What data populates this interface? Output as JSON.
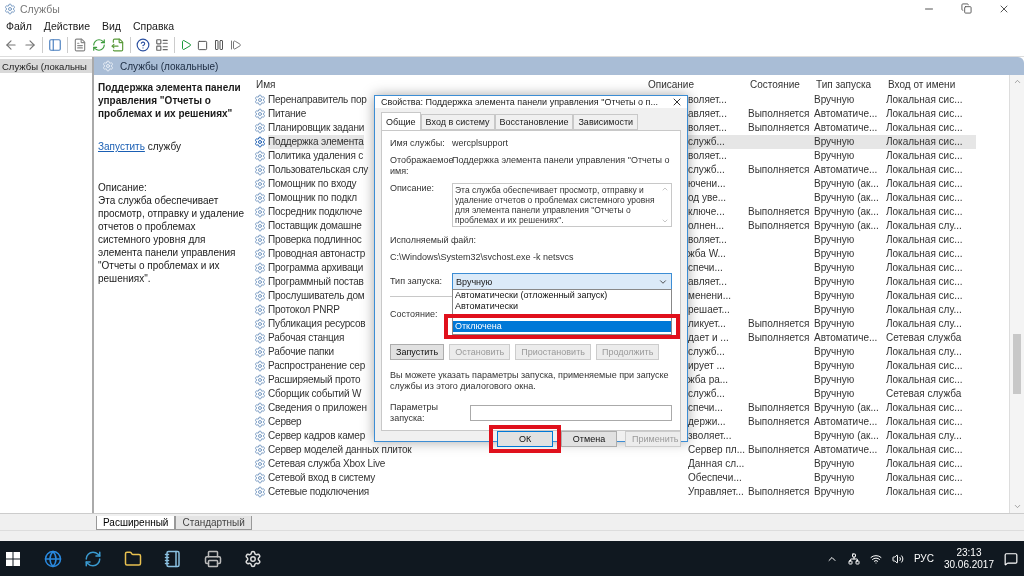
{
  "window": {
    "title": "Службы"
  },
  "menu": [
    "Файл",
    "Действие",
    "Вид",
    "Справка"
  ],
  "tree": {
    "items": [
      {
        "label": "Службы (локальны",
        "selected": true
      }
    ]
  },
  "panel": {
    "title": "Службы (локальные)"
  },
  "details": {
    "title": "Поддержка элемента панели управления \"Отчеты о проблемах и их решениях\"",
    "action_link": "Запустить",
    "action_text": "службу",
    "description_label": "Описание:",
    "description": "Эта служба обеспечивает просмотр, отправку и удаление отчетов о проблемах системного уровня для элемента панели управления \"Отчеты о проблемах и их решениях\"."
  },
  "table": {
    "columns": [
      "Имя",
      "Описание",
      "Состояние",
      "Тип запуска",
      "Вход от имени"
    ],
    "rows": [
      {
        "name": "Перенаправитель пор",
        "description": "воляет...",
        "state": "",
        "startup": "Вручную",
        "logon": "Локальная сис...",
        "selected": false
      },
      {
        "name": "Питание",
        "description": "авляет...",
        "state": "Выполняется",
        "startup": "Автоматиче...",
        "logon": "Локальная сис...",
        "selected": false
      },
      {
        "name": "Планировщик задани",
        "description": "воляет...",
        "state": "Выполняется",
        "startup": "Автоматиче...",
        "logon": "Локальная сис...",
        "selected": false
      },
      {
        "name": "Поддержка элемента",
        "description": "служб...",
        "state": "",
        "startup": "Вручную",
        "logon": "Локальная сис...",
        "selected": true
      },
      {
        "name": "Политика удаления с",
        "description": "воляет...",
        "state": "",
        "startup": "Вручную",
        "logon": "Локальная сис...",
        "selected": false
      },
      {
        "name": "Пользовательская слу",
        "description": "служб...",
        "state": "Выполняется",
        "startup": "Автоматиче...",
        "logon": "Локальная сис...",
        "selected": false
      },
      {
        "name": "Помощник по входу",
        "description": "ючени...",
        "state": "",
        "startup": "Вручную (ак...",
        "logon": "Локальная сис...",
        "selected": false
      },
      {
        "name": "Помощник по подкл",
        "description": "од уве...",
        "state": "",
        "startup": "Вручную (ак...",
        "logon": "Локальная сис...",
        "selected": false
      },
      {
        "name": "Посредник подключе",
        "description": "ключе...",
        "state": "Выполняется",
        "startup": "Вручную (ак...",
        "logon": "Локальная сис...",
        "selected": false
      },
      {
        "name": "Поставщик домашне",
        "description": "олнен...",
        "state": "Выполняется",
        "startup": "Вручную (ак...",
        "logon": "Локальная слу...",
        "selected": false
      },
      {
        "name": "Проверка подлиннос",
        "description": "воляет...",
        "state": "",
        "startup": "Вручную",
        "logon": "Локальная сис...",
        "selected": false
      },
      {
        "name": "Проводная автонастр",
        "description": "жба W...",
        "state": "",
        "startup": "Вручную",
        "logon": "Локальная сис...",
        "selected": false
      },
      {
        "name": "Программа архиваци",
        "description": "спечи...",
        "state": "",
        "startup": "Вручную",
        "logon": "Локальная сис...",
        "selected": false
      },
      {
        "name": "Программный постав",
        "description": "авляет...",
        "state": "",
        "startup": "Вручную",
        "logon": "Локальная сис...",
        "selected": false
      },
      {
        "name": "Прослушиватель дом",
        "description": "менени...",
        "state": "",
        "startup": "Вручную",
        "logon": "Локальная сис...",
        "selected": false
      },
      {
        "name": "Протокол PNRP",
        "description": "решает...",
        "state": "",
        "startup": "Вручную",
        "logon": "Локальная слу...",
        "selected": false
      },
      {
        "name": "Публикация ресурсов",
        "description": "ликует...",
        "state": "Выполняется",
        "startup": "Вручную",
        "logon": "Локальная слу...",
        "selected": false
      },
      {
        "name": "Рабочая станция",
        "description": "дает и ...",
        "state": "Выполняется",
        "startup": "Автоматиче...",
        "logon": "Сетевая служба",
        "selected": false
      },
      {
        "name": "Рабочие папки",
        "description": "служб...",
        "state": "",
        "startup": "Вручную",
        "logon": "Локальная слу...",
        "selected": false
      },
      {
        "name": "Распространение сер",
        "description": "ирует ...",
        "state": "",
        "startup": "Вручную",
        "logon": "Локальная сис...",
        "selected": false
      },
      {
        "name": "Расширяемый прото",
        "description": "жба ра...",
        "state": "",
        "startup": "Вручную",
        "logon": "Локальная сис...",
        "selected": false
      },
      {
        "name": "Сборщик событий W",
        "description": "служб...",
        "state": "",
        "startup": "Вручную",
        "logon": "Сетевая служба",
        "selected": false
      },
      {
        "name": "Сведения о приложен",
        "description": "спечи...",
        "state": "Выполняется",
        "startup": "Вручную (ак...",
        "logon": "Локальная сис...",
        "selected": false
      },
      {
        "name": "Сервер",
        "description": "держи...",
        "state": "Выполняется",
        "startup": "Автоматиче...",
        "logon": "Локальная сис...",
        "selected": false
      },
      {
        "name": "Сервер кадров камер",
        "description": "зволяет...",
        "state": "",
        "startup": "Вручную (ак...",
        "logon": "Локальная слу...",
        "selected": false
      },
      {
        "name": "Сервер моделей данных плиток",
        "description": "Сервер пл...",
        "state": "Выполняется",
        "startup": "Автоматиче...",
        "logon": "Локальная сис...",
        "selected": false
      },
      {
        "name": "Сетевая служба Xbox Live",
        "description": "Данная сл...",
        "state": "",
        "startup": "Вручную",
        "logon": "Локальная сис...",
        "selected": false
      },
      {
        "name": "Сетевой вход в систему",
        "description": "Обеспечи...",
        "state": "",
        "startup": "Вручную",
        "logon": "Локальная сис...",
        "selected": false
      },
      {
        "name": "Сетевые подключения",
        "description": "Управляет...",
        "state": "Выполняется",
        "startup": "Вручную",
        "logon": "Локальная сис...",
        "selected": false
      }
    ]
  },
  "view_tabs": [
    {
      "label": "Расширенный",
      "selected": true
    },
    {
      "label": "Стандартный",
      "selected": false
    }
  ],
  "dialog": {
    "title": "Свойства: Поддержка элемента панели управления \"Отчеты о п...",
    "tabs": [
      {
        "label": "Общие",
        "selected": true
      },
      {
        "label": "Вход в систему",
        "selected": false
      },
      {
        "label": "Восстановление",
        "selected": false
      },
      {
        "label": "Зависимости",
        "selected": false
      }
    ],
    "service_name_label": "Имя службы:",
    "service_name": "wercplsupport",
    "display_name_label": "Отображаемое имя:",
    "display_name": "Поддержка элемента панели управления \"Отчеты о",
    "description_label": "Описание:",
    "description": "Эта служба обеспечивает просмотр, отправку и удаление отчетов о проблемах системного уровня для элемента панели управления \"Отчеты о проблемах и их решениях\".",
    "executable_label": "Исполняемый файл:",
    "executable_path": "C:\\Windows\\System32\\svchost.exe -k netsvcs",
    "startup_label": "Тип запуска:",
    "startup_value": "Вручную",
    "startup_options": [
      {
        "label": "Автоматически (отложенный запуск)",
        "selected": false,
        "highlighted": false
      },
      {
        "label": "Автоматически",
        "selected": false,
        "highlighted": false
      },
      {
        "label": "Отключена",
        "selected": true,
        "highlighted": true
      }
    ],
    "state_label": "Состояние:",
    "service_buttons": [
      {
        "label": "Запустить",
        "disabled": false
      },
      {
        "label": "Остановить",
        "disabled": true
      },
      {
        "label": "Приостановить",
        "disabled": true
      },
      {
        "label": "Продолжить",
        "disabled": true
      }
    ],
    "hint": "Вы можете указать параметры запуска, применяемые при запуске службы из этого диалогового окна.",
    "params_label": "Параметры запуска:",
    "footer_buttons": [
      {
        "label": "ОК",
        "disabled": false,
        "highlighted": true
      },
      {
        "label": "Отмена",
        "disabled": false,
        "highlighted": false
      },
      {
        "label": "Применить",
        "disabled": true,
        "highlighted": false
      }
    ]
  },
  "taskbar": {
    "language": "РУС",
    "time": "23:13",
    "date": "30.06.2017"
  }
}
